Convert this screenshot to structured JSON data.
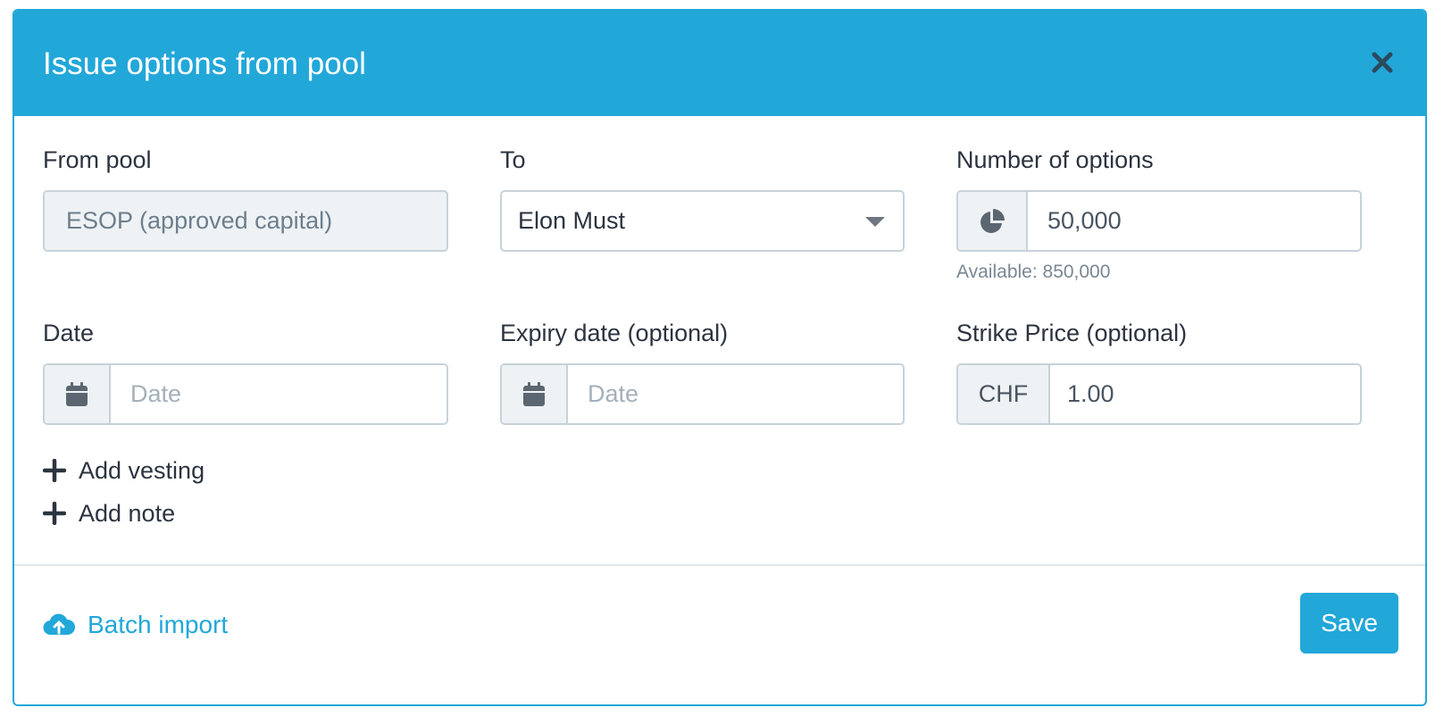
{
  "modal": {
    "title": "Issue options from pool"
  },
  "fields": {
    "from_pool": {
      "label": "From pool",
      "value": "ESOP (approved capital)"
    },
    "to": {
      "label": "To",
      "value": "Elon Must"
    },
    "number_of_options": {
      "label": "Number of options",
      "value": "50,000",
      "help": "Available: 850,000"
    },
    "date": {
      "label": "Date",
      "placeholder": "Date"
    },
    "expiry_date": {
      "label": "Expiry date (optional)",
      "placeholder": "Date"
    },
    "strike_price": {
      "label": "Strike Price (optional)",
      "currency": "CHF",
      "value": "1.00"
    }
  },
  "actions": {
    "add_vesting": "Add vesting",
    "add_note": "Add note",
    "batch_import": "Batch import",
    "save": "Save"
  },
  "icons": {
    "close": "close-icon",
    "pie_chart": "pie-chart-icon",
    "calendar": "calendar-icon",
    "plus": "plus-icon",
    "cloud_upload": "cloud-upload-icon"
  },
  "colors": {
    "accent": "#22a7d9",
    "text": "#2c3440",
    "muted": "#7a8793",
    "border": "#c8d2da",
    "addon_bg": "#eef2f5"
  }
}
